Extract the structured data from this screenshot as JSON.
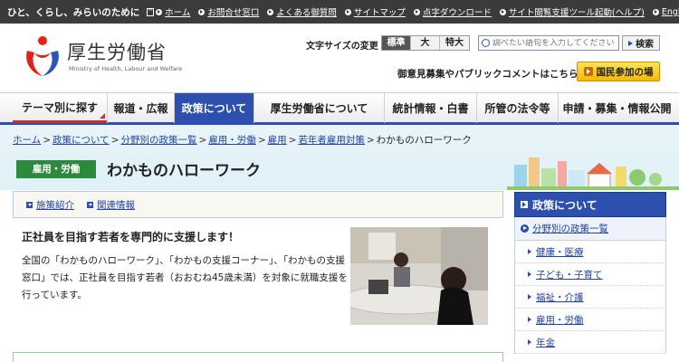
{
  "topbar": {
    "tagline": "ひと、くらし、みらいのために",
    "links": [
      "ホーム",
      "お問合せ窓口",
      "よくある御質問",
      "サイトマップ",
      "点字ダウンロード",
      "サイト閲覧支援ツール起動(ヘルプ)",
      "English"
    ]
  },
  "header": {
    "logo_text": "厚生労働省",
    "logo_sub": "Ministry of Health, Labour and Welfare",
    "fontsize_label": "文字サイズの変更",
    "fontsize_options": [
      "標準",
      "大",
      "特大"
    ],
    "search_placeholder": "調べたい語句を入力してください",
    "search_button": "検索",
    "opinion_text": "御意見募集やパブリックコメントはこちら",
    "participate_button": "国民参加の場"
  },
  "nav": {
    "items": [
      "テーマ別に探す",
      "報道・広報",
      "政策について",
      "厚生労働省について",
      "統計情報・白書",
      "所管の法令等",
      "申請・募集・情報公開"
    ]
  },
  "breadcrumb": [
    "ホーム",
    "政策について",
    "分野別の政策一覧",
    "雇用・労働",
    "雇用",
    "若年者雇用対策",
    "わかものハローワーク"
  ],
  "page": {
    "category": "雇用・労働",
    "title": "わかものハローワーク"
  },
  "main": {
    "anchor_links": [
      "施策紹介",
      "関連情報"
    ],
    "heading": "正社員を目指す若者を専門的に支援します！",
    "body": "全国の「わかものハローワーク」、「わかもの支援コーナー」、「わかもの支援窓口」では、正社員を目指す若者（おおむね45歳未満）を対象に就職支援を行っています。"
  },
  "sidebar": {
    "heading": "政策について",
    "sub": "分野別の政策一覧",
    "items": [
      "健康・医療",
      "子ども・子育て",
      "福祉・介護",
      "雇用・労働",
      "年金"
    ]
  }
}
